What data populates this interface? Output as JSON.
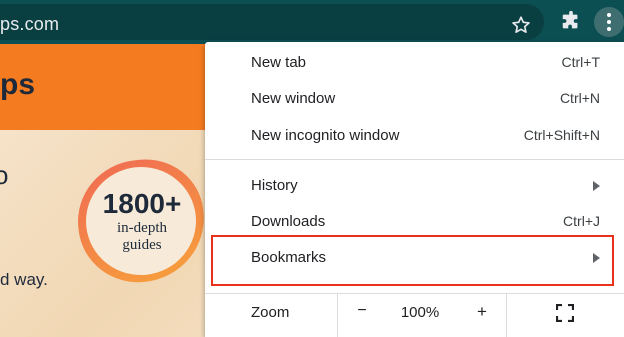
{
  "browser": {
    "url": "ps.com"
  },
  "page": {
    "logo": "ps",
    "partial_glyph": "o",
    "tagline": "d way.",
    "badge": {
      "number": "1800+",
      "line1": "in-depth",
      "line2": "guides"
    }
  },
  "menu": {
    "items": [
      {
        "label": "New tab",
        "shortcut": "Ctrl+T"
      },
      {
        "label": "New window",
        "shortcut": "Ctrl+N"
      },
      {
        "label": "New incognito window",
        "shortcut": "Ctrl+Shift+N"
      },
      {
        "label": "History",
        "shortcut": ""
      },
      {
        "label": "Downloads",
        "shortcut": "Ctrl+J"
      },
      {
        "label": "Bookmarks",
        "shortcut": ""
      }
    ],
    "zoom": {
      "label": "Zoom",
      "minus": "−",
      "value": "100%",
      "plus": "+"
    }
  },
  "colors": {
    "toolbar": "#0c4f52",
    "header_orange": "#f47b20",
    "highlight_red": "#e8321c"
  },
  "icons": {
    "bookmark_star": "star-icon",
    "extensions": "puzzle-icon",
    "menu": "kebab-menu-icon",
    "fullscreen": "fullscreen-icon",
    "submenu": "chevron-right-icon"
  }
}
